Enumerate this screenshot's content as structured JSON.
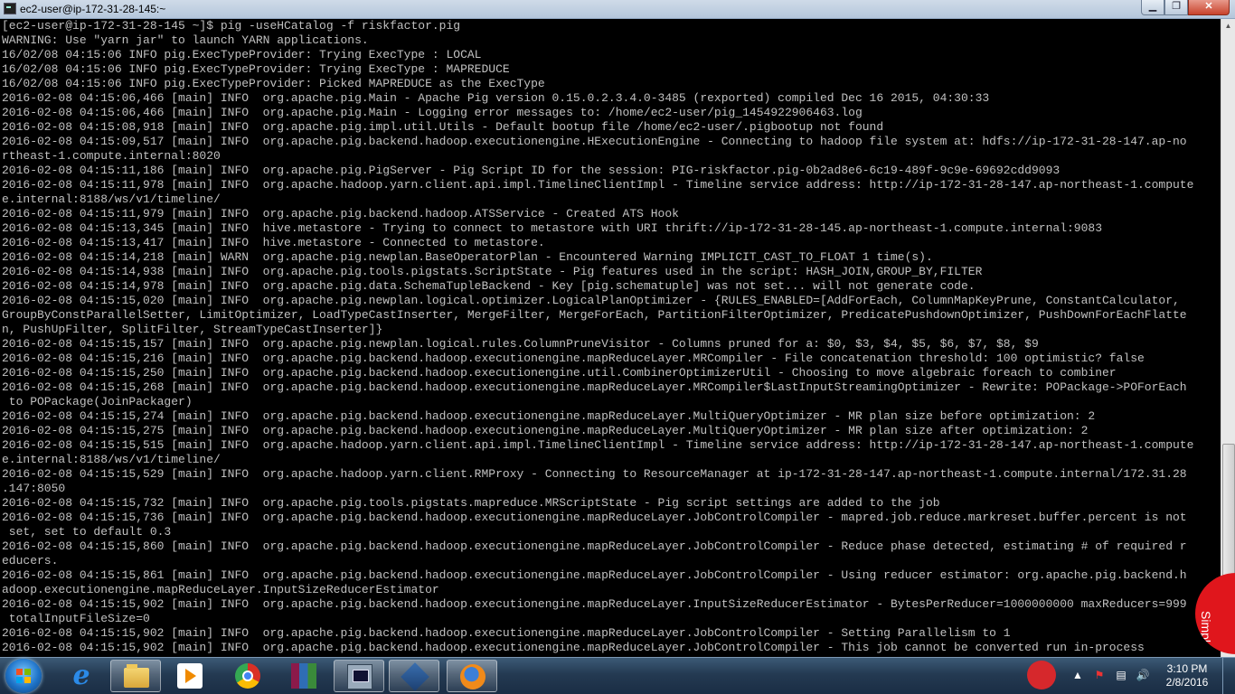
{
  "window": {
    "title": "ec2-user@ip-172-31-28-145:~",
    "buttons": {
      "minimize": "▁",
      "maximize": "❐",
      "close": "✕"
    }
  },
  "terminal": {
    "lines": [
      "[ec2-user@ip-172-31-28-145 ~]$ pig -useHCatalog -f riskfactor.pig",
      "WARNING: Use \"yarn jar\" to launch YARN applications.",
      "16/02/08 04:15:06 INFO pig.ExecTypeProvider: Trying ExecType : LOCAL",
      "16/02/08 04:15:06 INFO pig.ExecTypeProvider: Trying ExecType : MAPREDUCE",
      "16/02/08 04:15:06 INFO pig.ExecTypeProvider: Picked MAPREDUCE as the ExecType",
      "2016-02-08 04:15:06,466 [main] INFO  org.apache.pig.Main - Apache Pig version 0.15.0.2.3.4.0-3485 (rexported) compiled Dec 16 2015, 04:30:33",
      "2016-02-08 04:15:06,466 [main] INFO  org.apache.pig.Main - Logging error messages to: /home/ec2-user/pig_1454922906463.log",
      "2016-02-08 04:15:08,918 [main] INFO  org.apache.pig.impl.util.Utils - Default bootup file /home/ec2-user/.pigbootup not found",
      "2016-02-08 04:15:09,517 [main] INFO  org.apache.pig.backend.hadoop.executionengine.HExecutionEngine - Connecting to hadoop file system at: hdfs://ip-172-31-28-147.ap-no",
      "rtheast-1.compute.internal:8020",
      "2016-02-08 04:15:11,186 [main] INFO  org.apache.pig.PigServer - Pig Script ID for the session: PIG-riskfactor.pig-0b2ad8e6-6c19-489f-9c9e-69692cdd9093",
      "2016-02-08 04:15:11,978 [main] INFO  org.apache.hadoop.yarn.client.api.impl.TimelineClientImpl - Timeline service address: http://ip-172-31-28-147.ap-northeast-1.compute",
      "e.internal:8188/ws/v1/timeline/",
      "2016-02-08 04:15:11,979 [main] INFO  org.apache.pig.backend.hadoop.ATSService - Created ATS Hook",
      "2016-02-08 04:15:13,345 [main] INFO  hive.metastore - Trying to connect to metastore with URI thrift://ip-172-31-28-145.ap-northeast-1.compute.internal:9083",
      "2016-02-08 04:15:13,417 [main] INFO  hive.metastore - Connected to metastore.",
      "2016-02-08 04:15:14,218 [main] WARN  org.apache.pig.newplan.BaseOperatorPlan - Encountered Warning IMPLICIT_CAST_TO_FLOAT 1 time(s).",
      "2016-02-08 04:15:14,938 [main] INFO  org.apache.pig.tools.pigstats.ScriptState - Pig features used in the script: HASH_JOIN,GROUP_BY,FILTER",
      "2016-02-08 04:15:14,978 [main] INFO  org.apache.pig.data.SchemaTupleBackend - Key [pig.schematuple] was not set... will not generate code.",
      "2016-02-08 04:15:15,020 [main] INFO  org.apache.pig.newplan.logical.optimizer.LogicalPlanOptimizer - {RULES_ENABLED=[AddForEach, ColumnMapKeyPrune, ConstantCalculator,",
      "GroupByConstParallelSetter, LimitOptimizer, LoadTypeCastInserter, MergeFilter, MergeForEach, PartitionFilterOptimizer, PredicatePushdownOptimizer, PushDownForEachFlatte",
      "n, PushUpFilter, SplitFilter, StreamTypeCastInserter]}",
      "2016-02-08 04:15:15,157 [main] INFO  org.apache.pig.newplan.logical.rules.ColumnPruneVisitor - Columns pruned for a: $0, $3, $4, $5, $6, $7, $8, $9",
      "2016-02-08 04:15:15,216 [main] INFO  org.apache.pig.backend.hadoop.executionengine.mapReduceLayer.MRCompiler - File concatenation threshold: 100 optimistic? false",
      "2016-02-08 04:15:15,250 [main] INFO  org.apache.pig.backend.hadoop.executionengine.util.CombinerOptimizerUtil - Choosing to move algebraic foreach to combiner",
      "2016-02-08 04:15:15,268 [main] INFO  org.apache.pig.backend.hadoop.executionengine.mapReduceLayer.MRCompiler$LastInputStreamingOptimizer - Rewrite: POPackage->POForEach",
      " to POPackage(JoinPackager)",
      "2016-02-08 04:15:15,274 [main] INFO  org.apache.pig.backend.hadoop.executionengine.mapReduceLayer.MultiQueryOptimizer - MR plan size before optimization: 2",
      "2016-02-08 04:15:15,275 [main] INFO  org.apache.pig.backend.hadoop.executionengine.mapReduceLayer.MultiQueryOptimizer - MR plan size after optimization: 2",
      "2016-02-08 04:15:15,515 [main] INFO  org.apache.hadoop.yarn.client.api.impl.TimelineClientImpl - Timeline service address: http://ip-172-31-28-147.ap-northeast-1.compute",
      "e.internal:8188/ws/v1/timeline/",
      "2016-02-08 04:15:15,529 [main] INFO  org.apache.hadoop.yarn.client.RMProxy - Connecting to ResourceManager at ip-172-31-28-147.ap-northeast-1.compute.internal/172.31.28",
      ".147:8050",
      "2016-02-08 04:15:15,732 [main] INFO  org.apache.pig.tools.pigstats.mapreduce.MRScriptState - Pig script settings are added to the job",
      "2016-02-08 04:15:15,736 [main] INFO  org.apache.pig.backend.hadoop.executionengine.mapReduceLayer.JobControlCompiler - mapred.job.reduce.markreset.buffer.percent is not",
      " set, set to default 0.3",
      "2016-02-08 04:15:15,860 [main] INFO  org.apache.pig.backend.hadoop.executionengine.mapReduceLayer.JobControlCompiler - Reduce phase detected, estimating # of required r",
      "educers.",
      "2016-02-08 04:15:15,861 [main] INFO  org.apache.pig.backend.hadoop.executionengine.mapReduceLayer.JobControlCompiler - Using reducer estimator: org.apache.pig.backend.h",
      "adoop.executionengine.mapReduceLayer.InputSizeReducerEstimator",
      "2016-02-08 04:15:15,902 [main] INFO  org.apache.pig.backend.hadoop.executionengine.mapReduceLayer.InputSizeReducerEstimator - BytesPerReducer=1000000000 maxReducers=999",
      " totalInputFileSize=0",
      "2016-02-08 04:15:15,902 [main] INFO  org.apache.pig.backend.hadoop.executionengine.mapReduceLayer.JobControlCompiler - Setting Parallelism to 1",
      "2016-02-08 04:15:15,902 [main] INFO  org.apache.pig.backend.hadoop.executionengine.mapReduceLayer.JobControlCompiler - This job cannot be converted run in-process"
    ]
  },
  "overlay": {
    "simpletap_label": "SimpleTap"
  },
  "taskbar": {
    "pinned": [
      {
        "name": "internet-explorer",
        "glyph": "e"
      },
      {
        "name": "windows-explorer"
      },
      {
        "name": "media-player"
      },
      {
        "name": "chrome"
      },
      {
        "name": "winrar"
      },
      {
        "name": "putty",
        "active": true
      },
      {
        "name": "virtualbox"
      },
      {
        "name": "firefox"
      }
    ],
    "tray": {
      "show_hidden": "▲",
      "flag": "⚑",
      "network": "▤",
      "volume": "🔊"
    },
    "clock": {
      "time": "3:10 PM",
      "date": "2/8/2016"
    }
  },
  "colors": {
    "terminal_fg": "#c0c0c0",
    "terminal_bg": "#000000",
    "simpletap": "#e0161c"
  }
}
